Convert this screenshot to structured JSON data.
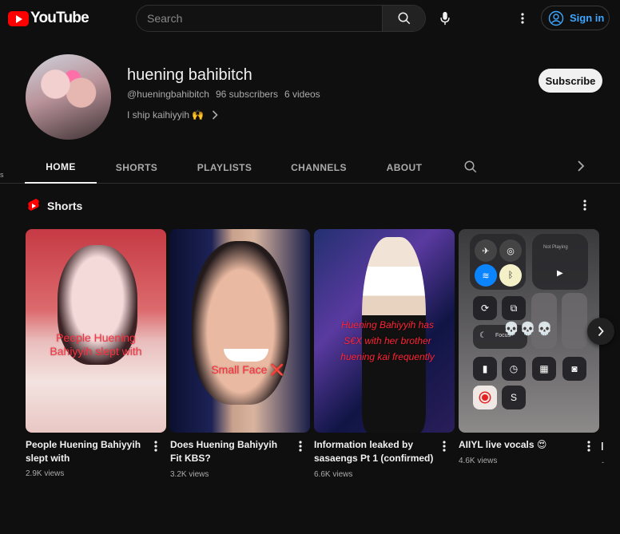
{
  "header": {
    "logo_text": "YouTube",
    "search_placeholder": "Search",
    "sign_in_label": "Sign in"
  },
  "channel": {
    "name": "huening bahibitch",
    "handle": "@hueningbahibitch",
    "subscribers": "96 subscribers",
    "videos": "6 videos",
    "description": "I ship kaihiyyih 🙌",
    "subscribe_label": "Subscribe"
  },
  "tabs": [
    {
      "label": "HOME",
      "active": true
    },
    {
      "label": "SHORTS",
      "active": false
    },
    {
      "label": "PLAYLISTS",
      "active": false
    },
    {
      "label": "CHANNELS",
      "active": false
    },
    {
      "label": "ABOUT",
      "active": false
    }
  ],
  "shorts": {
    "section_title": "Shorts",
    "items": [
      {
        "title": "People Huening Bahiyyih slept with",
        "views": "2.9K views",
        "overlay": "People Huening Bahiyyih slept with"
      },
      {
        "title": "Does Huening Bahiyyih Fit KBS?",
        "views": "3.2K views",
        "overlay": "Small Face ❌"
      },
      {
        "title": "Information leaked by sasaengs Pt 1 (confirmed)",
        "views": "6.6K views",
        "overlay": "Huening Bahiyyih has S€X with her brother huening kai frequently"
      },
      {
        "title": "AIIYL live vocals 😍",
        "views": "4.6K views",
        "overlay": "💀💀💀"
      }
    ],
    "control_center": {
      "now_playing": "Not Playing",
      "focus": "Focus"
    }
  },
  "edge": {
    "left_char": "s",
    "right_dash": "-"
  },
  "colors": {
    "background": "#0f0f0f",
    "accent_red": "#ff0000",
    "link_blue": "#3ea6ff"
  }
}
